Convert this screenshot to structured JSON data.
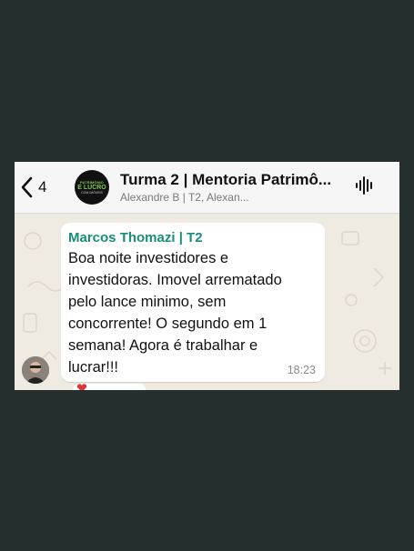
{
  "header": {
    "back_count": "4",
    "title": "Turma 2 | Mentoria Patrimô...",
    "subtitle": "Alexandre B                  | T2, Alexan...",
    "avatar_logo": {
      "line1": "PATRIMÔNIO",
      "line2": "E LUCRO",
      "line3": "COM IMÓVEIS"
    }
  },
  "message": {
    "sender": "Marcos Thomazi | T2",
    "text": "Boa noite investidores e\ninvestidoras.  Imovel arrematado\npelo lance minimo, sem\nconcorrente! O segundo em 1\nsemana!  Agora é trabalhar e\nlucrar!!!",
    "time": "18:23"
  },
  "colors": {
    "page_background": "#242f2e",
    "chat_background": "#efeae2",
    "header_background": "#f6f6f6",
    "sender_name": "#1a8d7a",
    "logo_green": "#7ec84a"
  },
  "icons": {
    "back": "chevron-left-icon",
    "audio": "audio-waveform-icon",
    "reaction": "heart-icon"
  }
}
